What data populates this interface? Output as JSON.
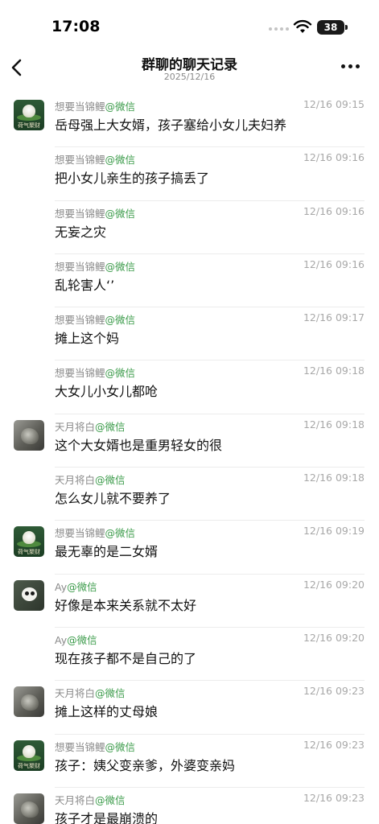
{
  "status_bar": {
    "time": "17:08",
    "battery": "38"
  },
  "header": {
    "title": "群聊的聊天记录",
    "date": "2025/12/16"
  },
  "messages": [
    {
      "sender": "想要当锦鲤",
      "source": "@微信",
      "time": "12/16 09:15",
      "text": "岳母强上大女婿，孩子塞给小女儿夫妇养",
      "avatar": "lotus-avatar",
      "avatar_caption": "荷气聚财"
    },
    {
      "sender": "想要当锦鲤",
      "source": "@微信",
      "time": "12/16 09:16",
      "text": "把小女儿亲生的孩子搞丢了",
      "avatar": ""
    },
    {
      "sender": "想要当锦鲤",
      "source": "@微信",
      "time": "12/16 09:16",
      "text": "无妄之灾",
      "avatar": ""
    },
    {
      "sender": "想要当锦鲤",
      "source": "@微信",
      "time": "12/16 09:16",
      "text": "乱轮害人‘’",
      "avatar": ""
    },
    {
      "sender": "想要当锦鲤",
      "source": "@微信",
      "time": "12/16 09:17",
      "text": "摊上这个妈",
      "avatar": ""
    },
    {
      "sender": "想要当锦鲤",
      "source": "@微信",
      "time": "12/16 09:18",
      "text": "大女儿小女儿都呛",
      "avatar": ""
    },
    {
      "sender": "天月将白",
      "source": "@微信",
      "time": "12/16 09:18",
      "text": "这个大女婿也是重男轻女的很",
      "avatar": "cat-avatar"
    },
    {
      "sender": "天月将白",
      "source": "@微信",
      "time": "12/16 09:18",
      "text": "怎么女儿就不要养了",
      "avatar": ""
    },
    {
      "sender": "想要当锦鲤",
      "source": "@微信",
      "time": "12/16 09:19",
      "text": "最无辜的是二女婿",
      "avatar": "lotus-avatar",
      "avatar_caption": "荷气聚财"
    },
    {
      "sender": "Ay",
      "source": "@微信",
      "time": "12/16 09:20",
      "text": "好像是本来关系就不太好",
      "avatar": "panda-avatar"
    },
    {
      "sender": "Ay",
      "source": "@微信",
      "time": "12/16 09:20",
      "text": "现在孩子都不是自己的了",
      "avatar": ""
    },
    {
      "sender": "天月将白",
      "source": "@微信",
      "time": "12/16 09:23",
      "text": "摊上这样的丈母娘",
      "avatar": "cat-avatar"
    },
    {
      "sender": "想要当锦鲤",
      "source": "@微信",
      "time": "12/16 09:23",
      "text": "孩子：姨父变亲爹，外婆变亲妈",
      "avatar": "lotus-avatar",
      "avatar_caption": "荷气聚财"
    },
    {
      "sender": "天月将白",
      "source": "@微信",
      "time": "12/16 09:23",
      "text": "孩子才是最崩溃的",
      "avatar": "cat-avatar"
    }
  ]
}
